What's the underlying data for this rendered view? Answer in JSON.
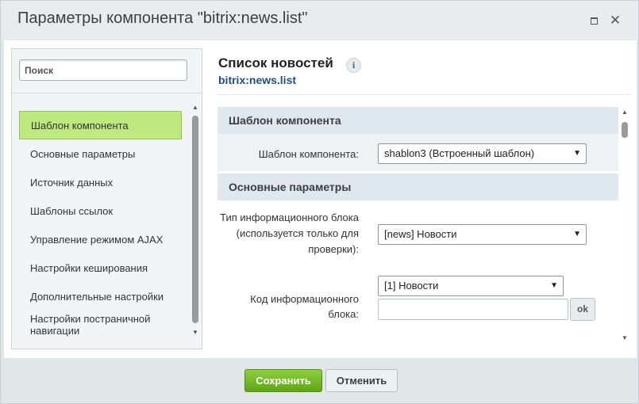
{
  "dialog": {
    "title": "Параметры компонента \"bitrix:news.list\"",
    "maximize_icon": "maximize-icon",
    "close_icon": "close-icon",
    "close_glyph": "✕"
  },
  "sidebar": {
    "search_placeholder": "Поиск",
    "items": [
      {
        "label": "Шаблон компонента"
      },
      {
        "label": "Основные параметры"
      },
      {
        "label": "Источник данных"
      },
      {
        "label": "Шаблоны ссылок"
      },
      {
        "label": "Управление режимом AJAX"
      },
      {
        "label": "Настройки кеширования"
      },
      {
        "label": "Дополнительные настройки"
      },
      {
        "label": "Настройки постраничной навигации"
      }
    ],
    "active_index": 0
  },
  "component": {
    "title": "Список новостей",
    "info_glyph": "i",
    "code": "bitrix:news.list"
  },
  "form": {
    "sections": [
      {
        "title": "Шаблон компонента"
      },
      {
        "title": "Основные параметры"
      }
    ],
    "template_label": "Шаблон компонента:",
    "template_value": "shablon3 (Встроенный шаблон)",
    "iblock_type_label_1": "Тип информационного блока",
    "iblock_type_label_2": "(используется только для",
    "iblock_type_label_3": "проверки):",
    "iblock_type_value": "[news] Новости",
    "iblock_code_label_1": "Код информационного",
    "iblock_code_label_2": "блока:",
    "iblock_code_value": "[1] Новости",
    "iblock_code_input": "",
    "ok_label": "ok"
  },
  "footer": {
    "save_label": "Сохранить",
    "cancel_label": "Отменить"
  },
  "colors": {
    "active_item": "#bde97e",
    "save_button": "#6cb51f",
    "section_header": "#dfe8ee",
    "link_blue": "#1d4f86"
  }
}
